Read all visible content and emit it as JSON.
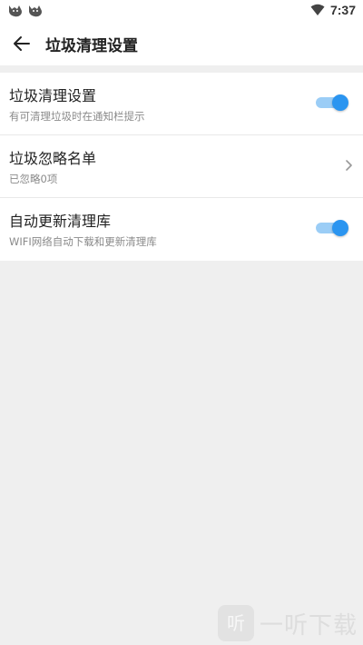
{
  "status_bar": {
    "time": "7:37",
    "notification_icons": [
      "cat-notification-icon",
      "cat-notification-icon"
    ],
    "wifi_icon": "wifi-icon"
  },
  "app_bar": {
    "back_icon": "arrow-left-icon",
    "title": "垃圾清理设置"
  },
  "settings": [
    {
      "title": "垃圾清理设置",
      "subtitle": "有可清理垃圾时在通知栏提示",
      "control": "toggle",
      "enabled": true
    },
    {
      "title": "垃圾忽略名单",
      "subtitle": "已忽略0项",
      "control": "chevron",
      "icon": "chevron-right-icon"
    },
    {
      "title": "自动更新清理库",
      "subtitle": "WIFI网络自动下载和更新清理库",
      "control": "toggle",
      "enabled": true
    }
  ],
  "colors": {
    "accent": "#2b95f0",
    "accent_light": "#9bcdf6",
    "background": "#efefef",
    "surface": "#ffffff"
  },
  "watermark": {
    "text": "一听下载",
    "logo_text": "听"
  }
}
